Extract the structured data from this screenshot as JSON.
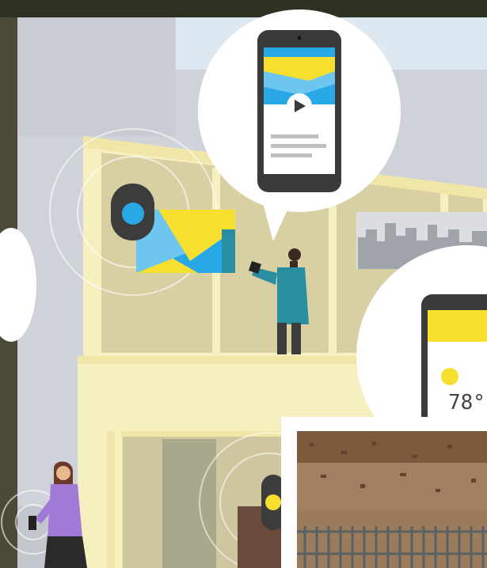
{
  "weather_card": {
    "temperature_text": "78°"
  },
  "colors": {
    "sky_light": "#dde8f1",
    "wall_gray": "#cfd2d8",
    "building_cream": "#f6efbf",
    "building_trim": "#efe6a8",
    "interior_tan": "#d8cfa2",
    "accent_blue": "#29a8e8",
    "accent_yellow": "#f6df2e",
    "teal_shirt": "#2a8ea2",
    "purple_coat": "#a17ad8",
    "beacon_dark": "#3c3c3c",
    "skyline_gray": "#9ea4aa",
    "brick_brown": "#8a6a48"
  },
  "icons": [
    "play-icon",
    "beacon-icon",
    "sun-icon",
    "phone-icon"
  ]
}
